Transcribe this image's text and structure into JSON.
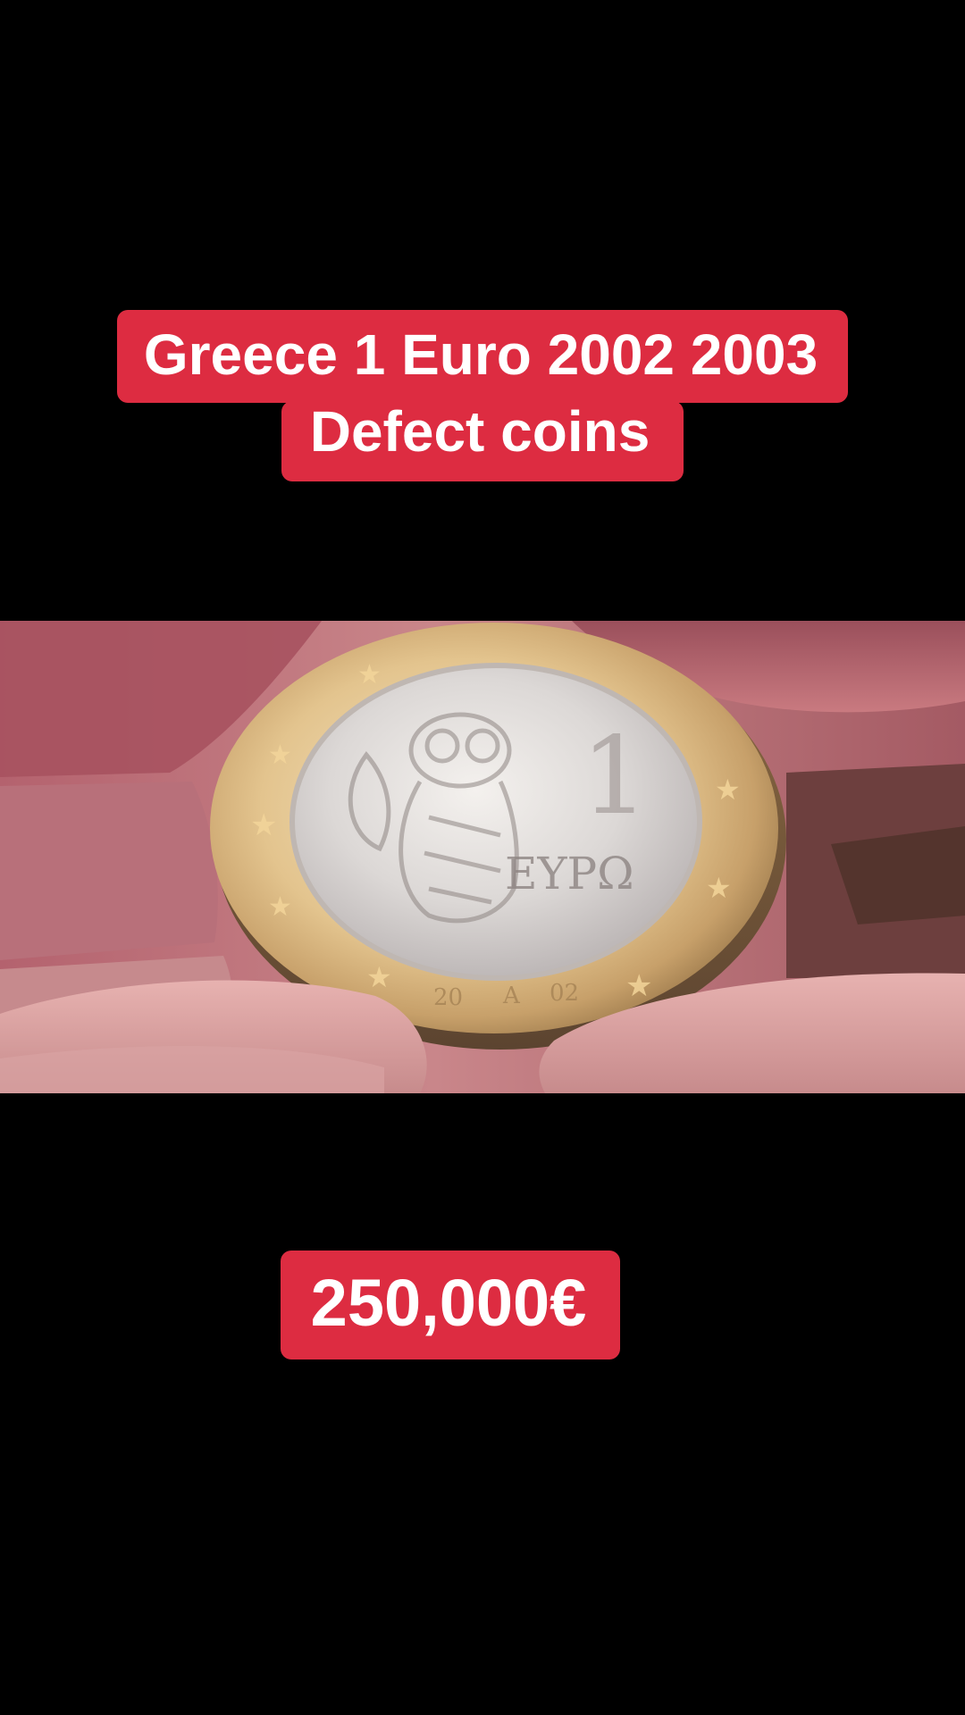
{
  "title": {
    "line1": "Greece 1 Euro 2002 2003",
    "line2": "Defect coins"
  },
  "price": "250,000€",
  "photo": {
    "coin_country_text": "ΕΥΡΩ",
    "coin_denomination": "1",
    "coin_year_left": "20",
    "coin_year_right": "02",
    "coin_mint_mark": "A"
  },
  "colors": {
    "background": "#000000",
    "caption_background": "#dd2c41",
    "caption_text": "#ffffff"
  }
}
